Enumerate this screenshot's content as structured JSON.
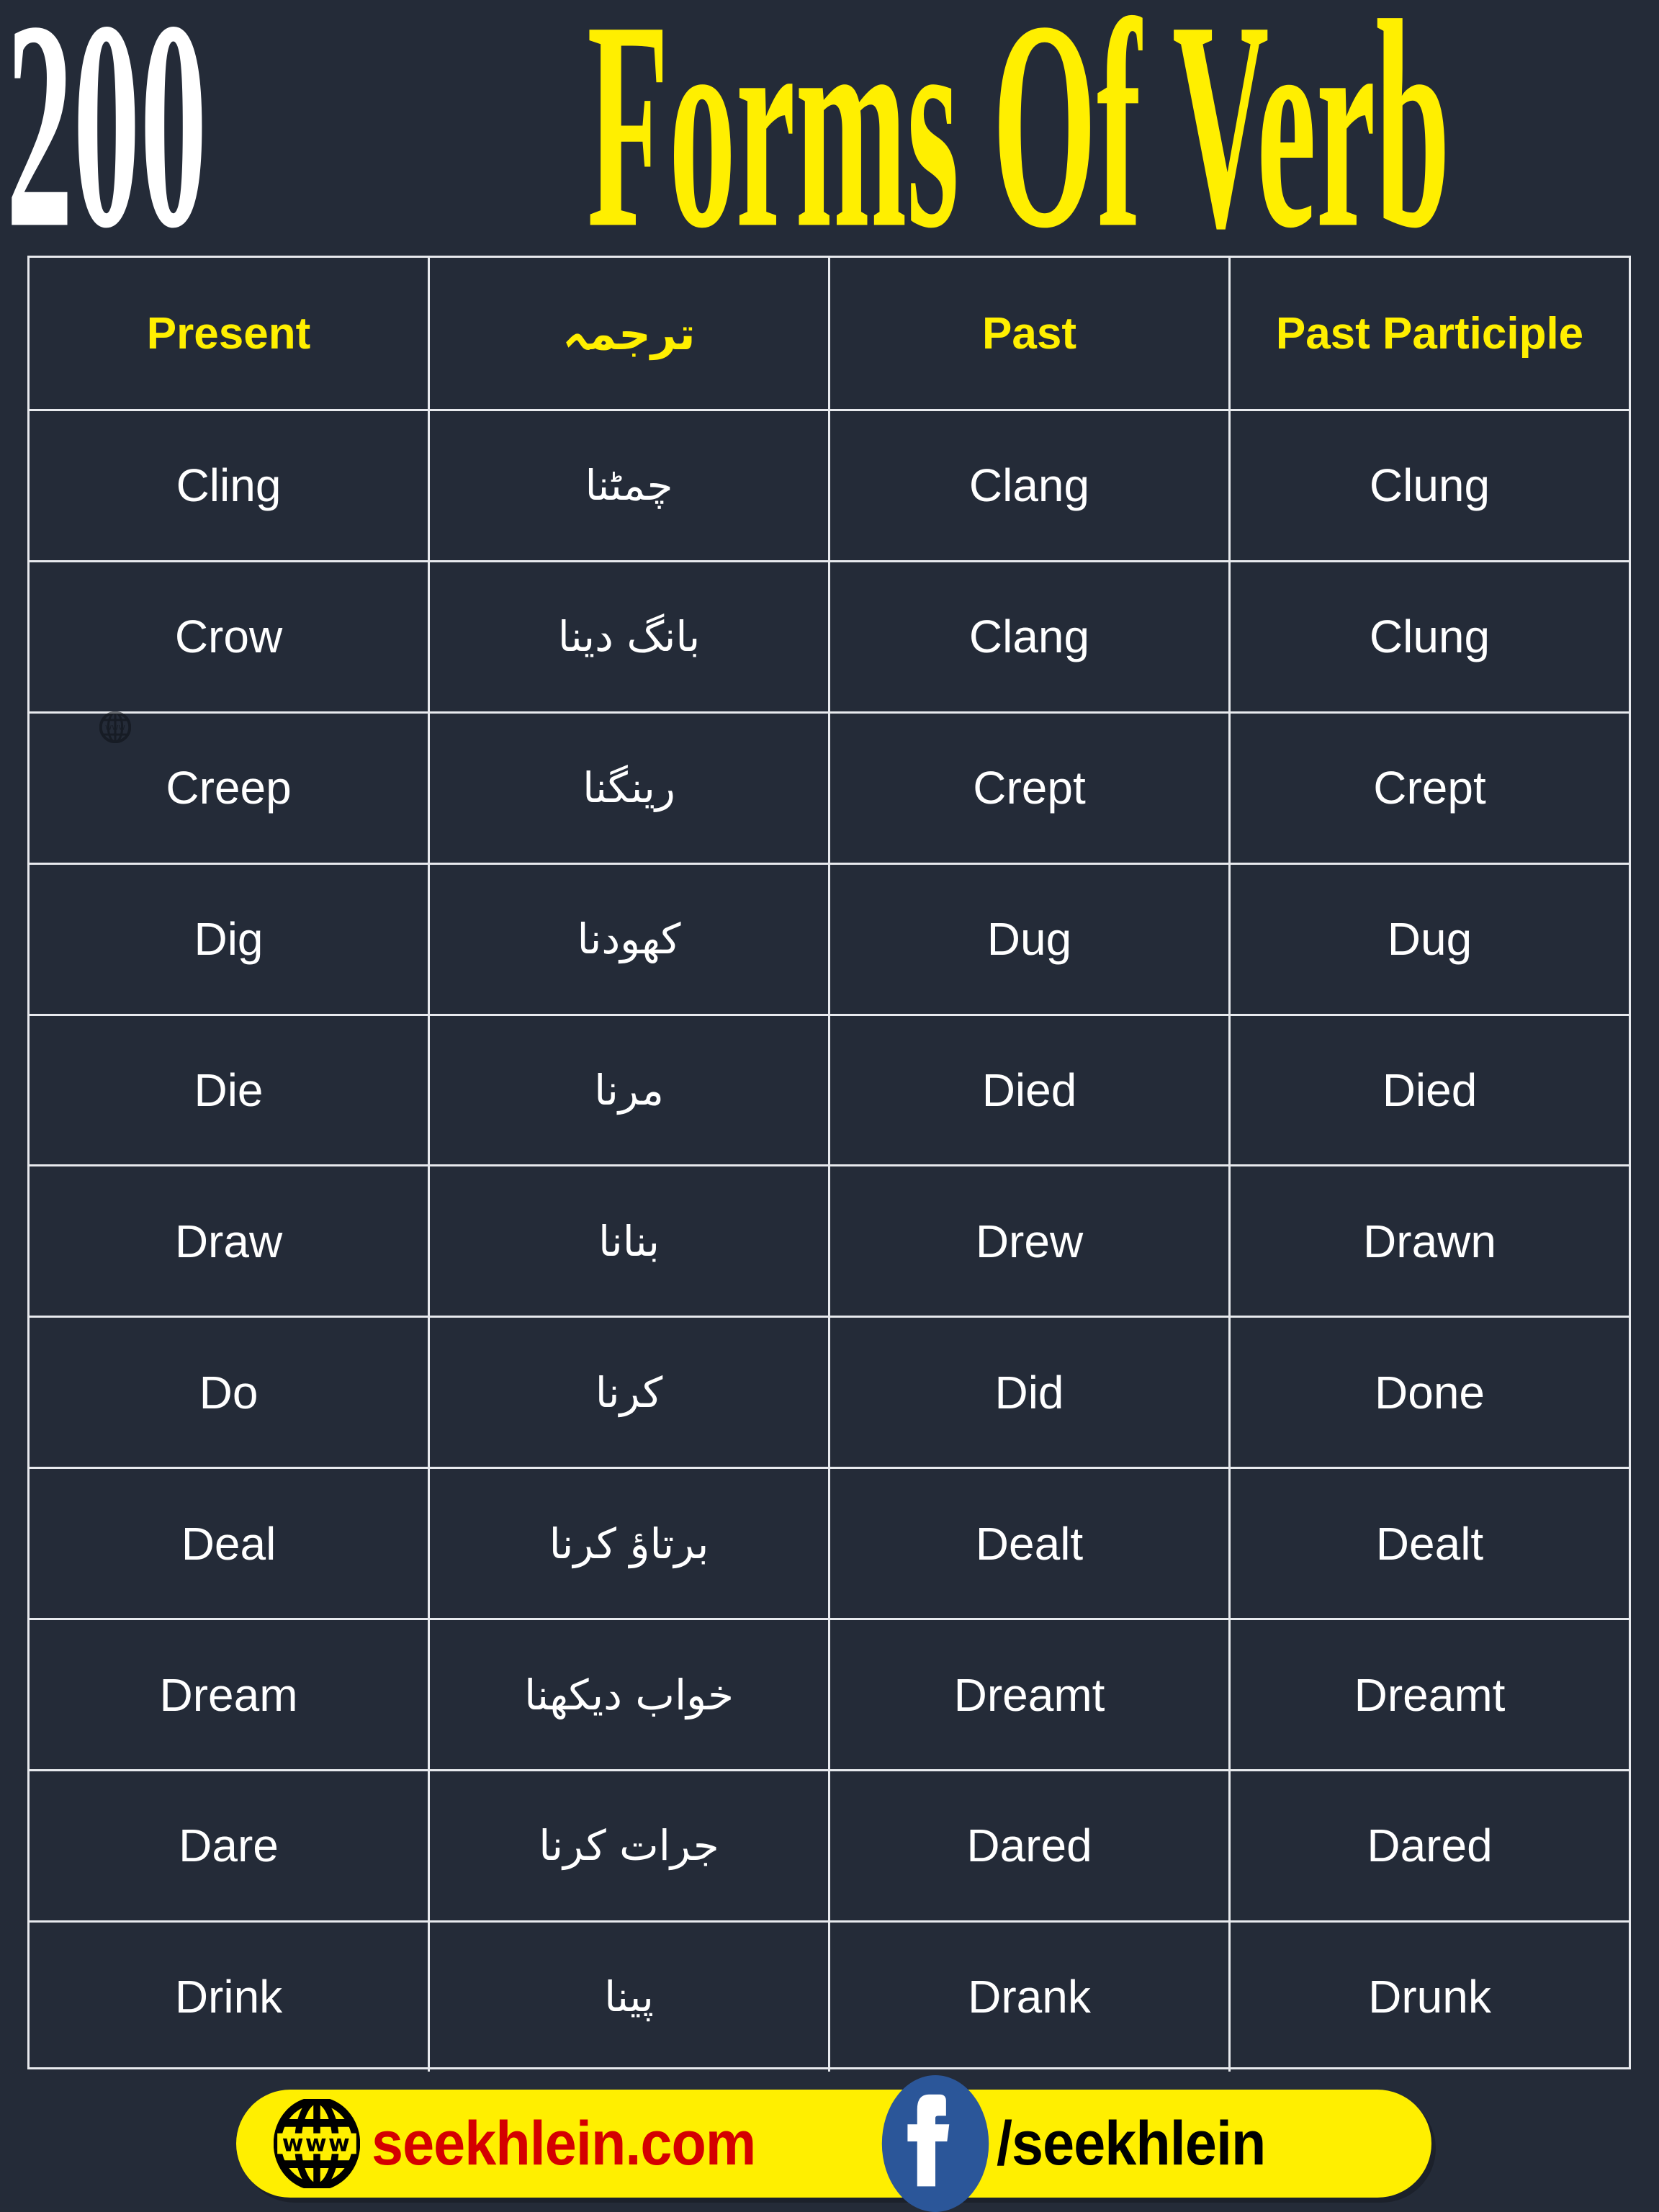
{
  "title": {
    "number": "200",
    "rest": "Forms Of Verb"
  },
  "colors": {
    "background": "#242b38",
    "accent_yellow": "#ffef00",
    "text_white": "#ffffff",
    "border": "#e8eaee",
    "brand_red": "#d40000",
    "facebook_blue": "#2b5699"
  },
  "table": {
    "headers": [
      "Present",
      "ترجمہ",
      "Past",
      "Past Participle"
    ],
    "rows": [
      {
        "present": "Cling",
        "urdu": "چمٹنا",
        "past": "Clang",
        "participle": "Clung"
      },
      {
        "present": "Crow",
        "urdu": "بانگ دینا",
        "past": "Clang",
        "participle": "Clung"
      },
      {
        "present": "Creep",
        "urdu": "رینگنا",
        "past": "Crept",
        "participle": "Crept"
      },
      {
        "present": "Dig",
        "urdu": "کھودنا",
        "past": "Dug",
        "participle": "Dug"
      },
      {
        "present": "Die",
        "urdu": "مرنا",
        "past": "Died",
        "participle": "Died"
      },
      {
        "present": "Draw",
        "urdu": "بنانا",
        "past": "Drew",
        "participle": "Drawn"
      },
      {
        "present": "Do",
        "urdu": "کرنا",
        "past": "Did",
        "participle": "Done"
      },
      {
        "present": "Deal",
        "urdu": "برتاؤ کرنا",
        "past": "Dealt",
        "participle": "Dealt"
      },
      {
        "present": "Dream",
        "urdu": "خواب دیکھنا",
        "past": "Dreamt",
        "participle": "Dreamt"
      },
      {
        "present": "Dare",
        "urdu": "جرات کرنا",
        "past": "Dared",
        "participle": "Dared"
      },
      {
        "present": "Drink",
        "urdu": "پینا",
        "past": "Drank",
        "participle": "Drunk"
      }
    ]
  },
  "watermark": {
    "icon": "www-globe-icon"
  },
  "footer": {
    "website_icon": "www-globe-icon",
    "website": "seekhlein.com",
    "facebook_icon": "facebook-f-icon",
    "facebook_handle": "/seekhlein"
  }
}
